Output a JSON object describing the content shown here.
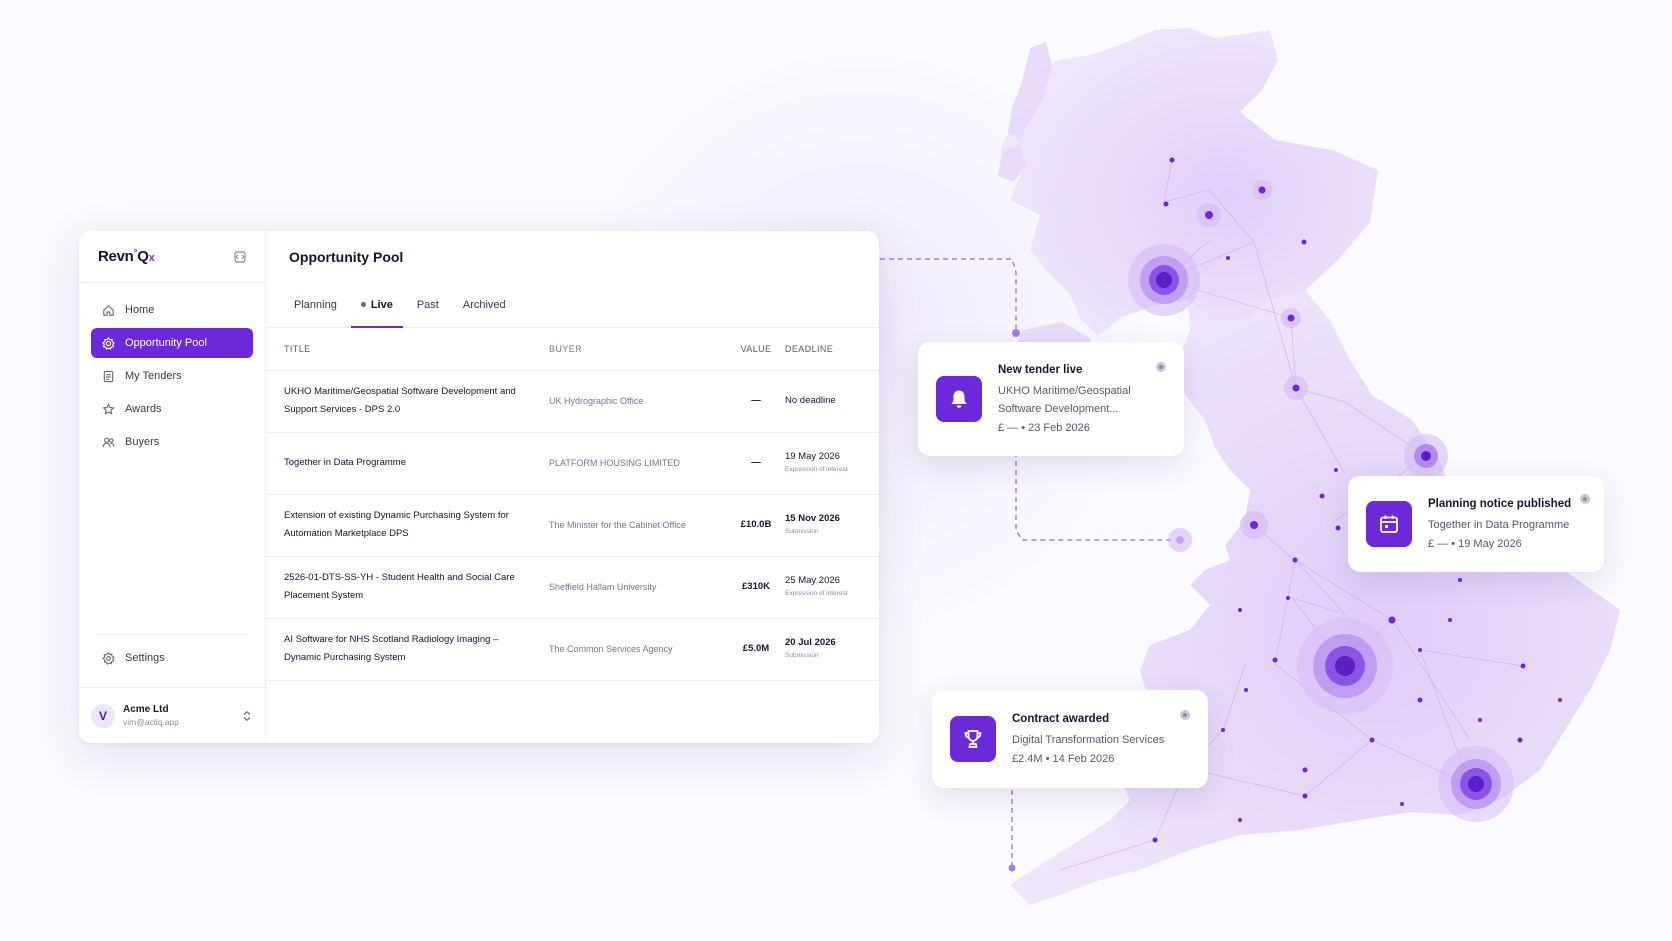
{
  "brand": {
    "logo_main": "Revn",
    "logo_sup": "°",
    "logo_q": "Q",
    "logo_x": "x"
  },
  "sidebar": {
    "items": [
      {
        "label": "Home",
        "icon": "home-icon"
      },
      {
        "label": "Opportunity Pool",
        "icon": "opportunity-icon",
        "active": true
      },
      {
        "label": "My Tenders",
        "icon": "document-icon"
      },
      {
        "label": "Awards",
        "icon": "award-icon"
      },
      {
        "label": "Buyers",
        "icon": "users-icon"
      }
    ],
    "settings_label": "Settings",
    "account": {
      "initial": "V",
      "name": "Acme Ltd",
      "email": "vim@acliq.app"
    }
  },
  "main": {
    "title": "Opportunity Pool",
    "tabs": [
      {
        "label": "Planning"
      },
      {
        "label": "Live",
        "active": true
      },
      {
        "label": "Past"
      },
      {
        "label": "Archived"
      }
    ],
    "columns": {
      "title": "TITLE",
      "buyer": "BUYER",
      "value": "VALUE",
      "deadline": "DEADLINE"
    },
    "rows": [
      {
        "title": "UKHO Maritime/Geospatial Software Development and Support Services - DPS 2.0",
        "buyer": "UK Hydrographic Office",
        "value": "—",
        "deadline": "No deadline",
        "deadline_sub": ""
      },
      {
        "title": "Together in Data Programme",
        "buyer": "PLATFORM HOUSING LIMITED",
        "value": "—",
        "deadline": "19 May 2026",
        "deadline_sub": "Expression of interest"
      },
      {
        "title": "Extension of existing Dynamic Purchasing System for Automation Marketplace DPS",
        "buyer": "The Minister for the Cabinet Office",
        "value": "£10.0B",
        "deadline": "15 Nov 2026",
        "deadline_sub": "Submission"
      },
      {
        "title": "2526-01-DTS-SS-YH - Student Health and Social Care Placement System",
        "buyer": "Sheffield Hallam University",
        "value": "£310K",
        "deadline": "25 May 2026",
        "deadline_sub": "Expression of interest"
      },
      {
        "title": "AI Software for NHS Scotland Radiology Imaging – Dynamic Purchasing System",
        "buyer": "The Common Services Agency",
        "value": "£5.0M",
        "deadline": "20 Jul 2026",
        "deadline_sub": "Submission"
      }
    ]
  },
  "cards": {
    "tender": {
      "title": "New tender live",
      "desc_line1": "UKHO Maritime/Geospatial",
      "desc_line2": "Software Development...",
      "meta": "£ —  •  23 Feb 2026",
      "icon": "bell-icon"
    },
    "planning": {
      "title": "Planning notice published",
      "desc_line1": "Together in Data Programme",
      "meta": "£ —  •  19 May 2026",
      "icon": "calendar-icon"
    },
    "award": {
      "title": "Contract awarded",
      "desc_line1": "Digital Transformation Services",
      "meta": "£2.4M  •  14 Feb 2026",
      "icon": "trophy-icon"
    }
  },
  "colors": {
    "accent": "#6d28d9",
    "map_fill": "#e9dcfb",
    "map_node": "#6d28d9"
  }
}
